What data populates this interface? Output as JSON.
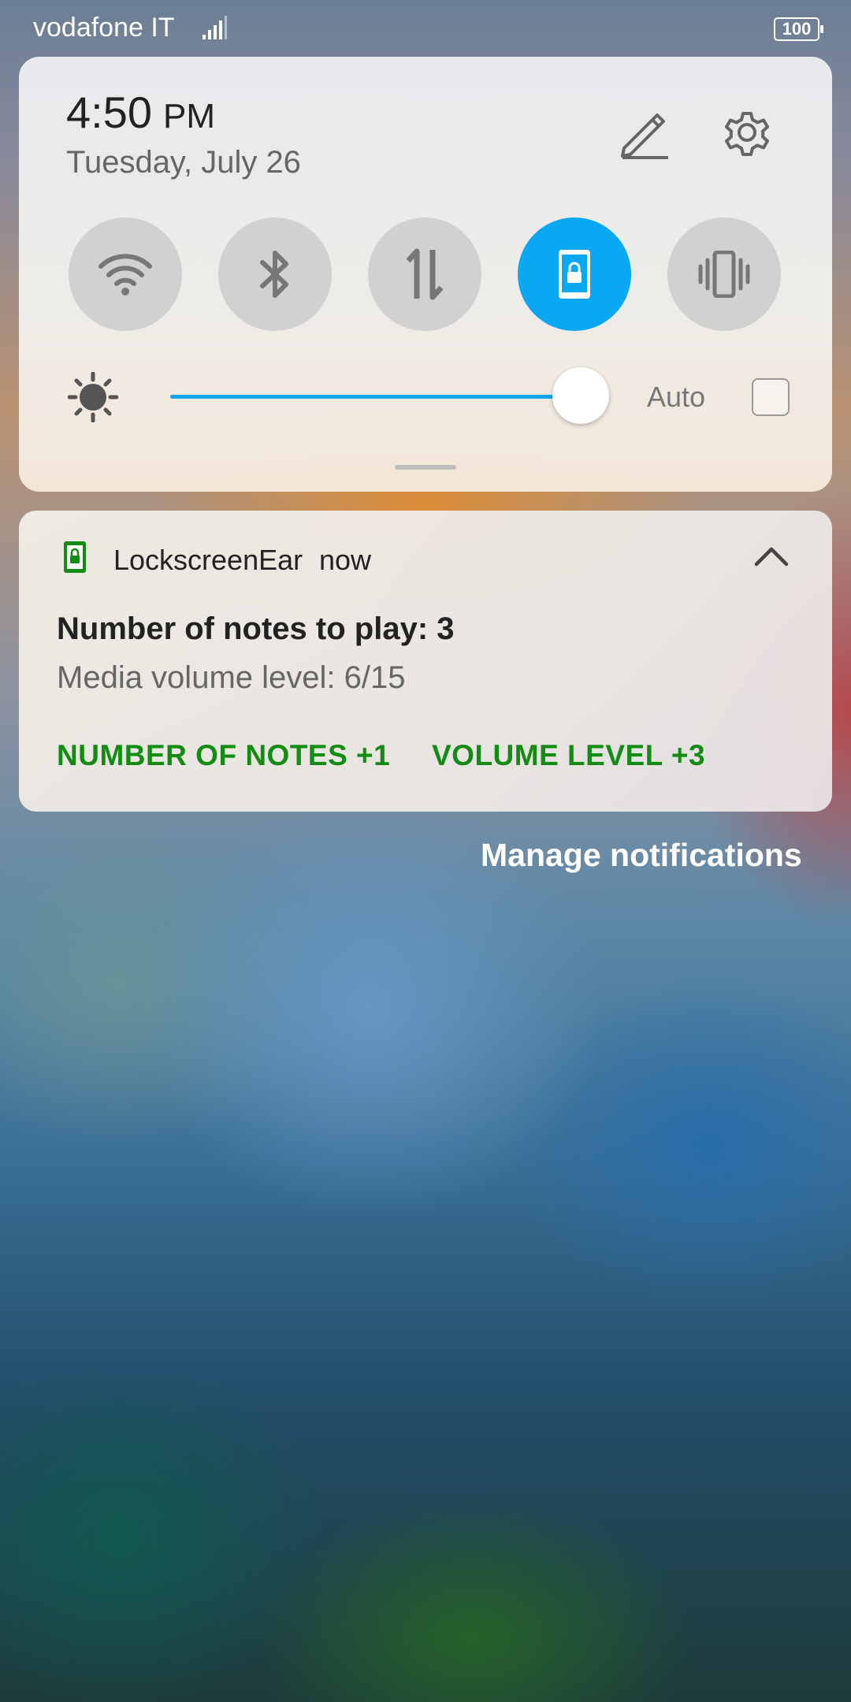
{
  "status_bar": {
    "carrier": "vodafone IT",
    "signal_icon": "cellular-signal-icon",
    "battery_level": "100"
  },
  "quick_settings": {
    "time": "4:50",
    "ampm": "PM",
    "date": "Tuesday, July 26",
    "edit_icon": "pencil-icon",
    "settings_icon": "gear-icon",
    "toggles": [
      {
        "icon": "wifi-icon",
        "active": false
      },
      {
        "icon": "bluetooth-icon",
        "active": false
      },
      {
        "icon": "mobile-data-icon",
        "active": false
      },
      {
        "icon": "screen-lock-rotation-icon",
        "active": true
      },
      {
        "icon": "vibrate-icon",
        "active": false
      }
    ],
    "brightness": {
      "icon": "brightness-icon",
      "level": 0.9,
      "auto_label": "Auto",
      "auto_checked": false
    },
    "accent_color": "#0aa8f2"
  },
  "notification": {
    "app_icon": "lock-phone-icon",
    "app_name": "LockscreenEar",
    "time": "now",
    "collapse_icon": "chevron-up-icon",
    "title": "Number of notes to play: 3",
    "text": "Media volume level: 6/15",
    "actions": [
      "NUMBER OF NOTES +1",
      "VOLUME LEVEL +3"
    ],
    "action_color": "#128c12"
  },
  "footer": {
    "manage_label": "Manage notifications"
  }
}
